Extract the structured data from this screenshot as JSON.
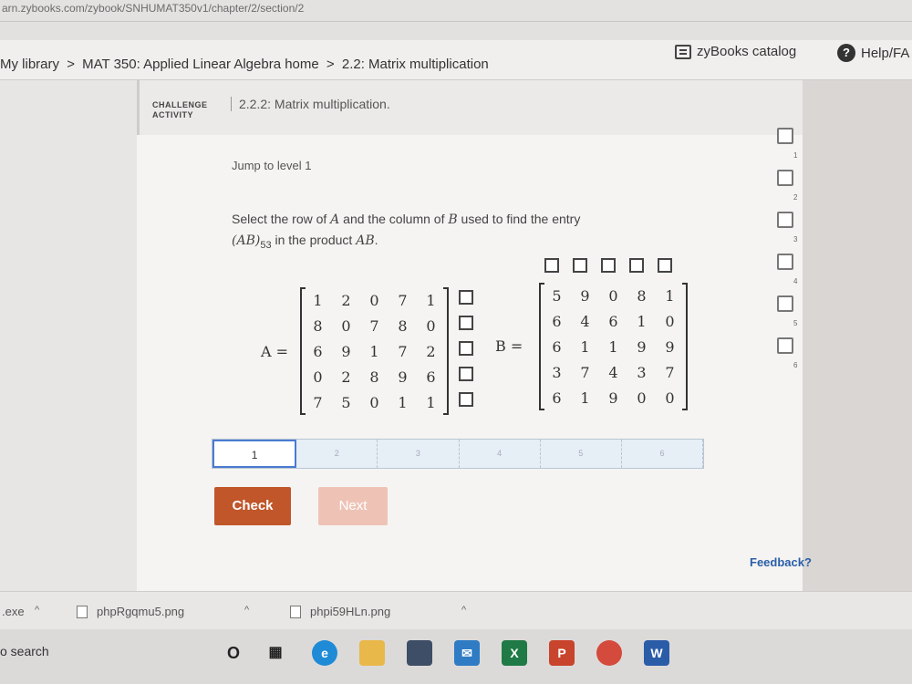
{
  "browser": {
    "url": "arn.zybooks.com/zybook/SNHUMAT350v1/chapter/2/section/2"
  },
  "header": {
    "breadcrumb": [
      "My library",
      ">",
      "MAT 350: Applied Linear Algebra home",
      ">",
      "2.2: Matrix multiplication"
    ],
    "catalog_label": "zyBooks catalog",
    "help_label": "Help/FA"
  },
  "activity": {
    "tag_line1": "CHALLENGE",
    "tag_line2": "ACTIVITY",
    "title": "2.2.2: Matrix multiplication.",
    "jump_label": "Jump to level 1",
    "prompt_part1": "Select the row of ",
    "prompt_A": "A",
    "prompt_part2": " and the column of ",
    "prompt_B": "B",
    "prompt_part3": " used to find the entry ",
    "prompt_entry": "(AB)",
    "prompt_sub": "53",
    "prompt_part4": " in the product ",
    "prompt_AB": "AB",
    "prompt_end": "."
  },
  "matrix_A": {
    "label": "A =",
    "rows": [
      [
        "1",
        "2",
        "0",
        "7",
        "1"
      ],
      [
        "8",
        "0",
        "7",
        "8",
        "0"
      ],
      [
        "6",
        "9",
        "1",
        "7",
        "2"
      ],
      [
        "0",
        "2",
        "8",
        "9",
        "6"
      ],
      [
        "7",
        "5",
        "0",
        "1",
        "1"
      ]
    ]
  },
  "matrix_B": {
    "label": "B =",
    "rows": [
      [
        "5",
        "9",
        "0",
        "8",
        "1"
      ],
      [
        "6",
        "4",
        "6",
        "1",
        "0"
      ],
      [
        "6",
        "1",
        "1",
        "9",
        "9"
      ],
      [
        "3",
        "7",
        "4",
        "3",
        "7"
      ],
      [
        "6",
        "1",
        "9",
        "0",
        "0"
      ]
    ]
  },
  "levels": [
    "1",
    "2",
    "3",
    "4",
    "5",
    "6"
  ],
  "buttons": {
    "check": "Check",
    "next": "Next"
  },
  "feedback_label": "Feedback?",
  "right_nav": [
    "1",
    "2",
    "3",
    "4",
    "5",
    "6"
  ],
  "downloads": [
    {
      "name": ".exe"
    },
    {
      "name": "phpRgqmu5.png"
    },
    {
      "name": "phpi59HLn.png"
    }
  ],
  "taskbar": {
    "search_label": "o search"
  }
}
